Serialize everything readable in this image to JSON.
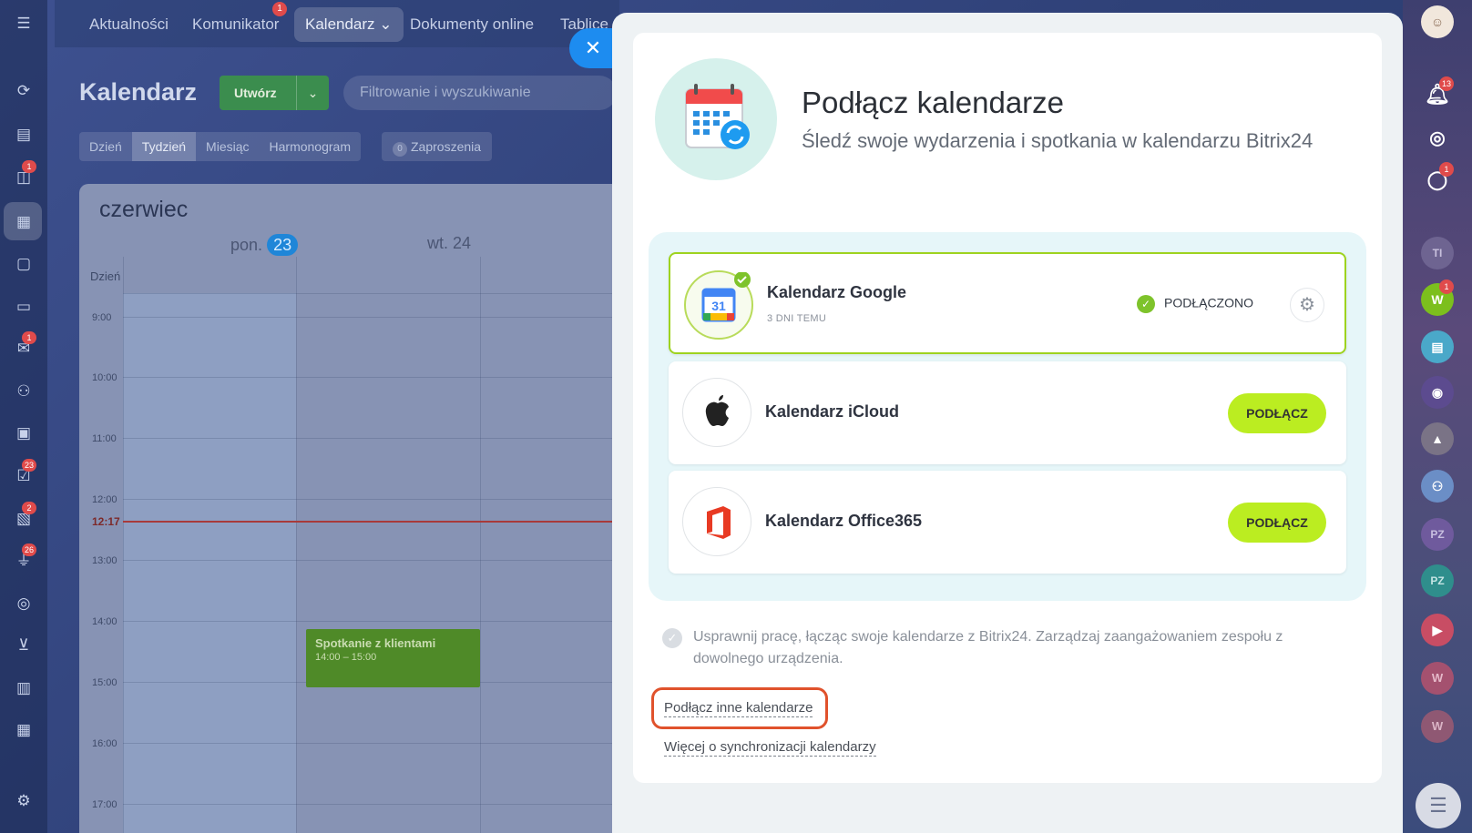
{
  "app": {
    "topnav": [
      {
        "label": "Aktualności"
      },
      {
        "label": "Komunikator",
        "badge": "1"
      },
      {
        "label": "Kalendarz"
      },
      {
        "label": "Dokumenty online"
      },
      {
        "label": "Tablice"
      }
    ],
    "calendar": {
      "title": "Kalendarz",
      "create_label": "Utwórz",
      "filter_placeholder": "Filtrowanie i wyszukiwanie",
      "views": [
        "Dzień",
        "Tydzień",
        "Miesiąc",
        "Harmonogram"
      ],
      "invites_count": "0",
      "invites_label": "Zaproszenia",
      "month": "czerwiec",
      "days": [
        {
          "label": "pon.",
          "num": "23"
        },
        {
          "label": "wt. 24"
        }
      ],
      "allday_label": "Dzień",
      "hours": [
        "9:00",
        "10:00",
        "11:00",
        "12:00",
        "13:00",
        "14:00",
        "15:00",
        "16:00",
        "17:00"
      ],
      "now_time": "12:17",
      "event": {
        "title": "Spotkanie z klientami",
        "time": "14:00 – 15:00"
      }
    },
    "left_badges": [
      "1",
      "1",
      "23",
      "2",
      "26"
    ],
    "right_rail": {
      "notifications_badge": "13",
      "chat_badge": "1",
      "avatars": [
        "TI",
        "W",
        "PZ",
        "PZ",
        "W",
        "W"
      ],
      "w_badge": "1"
    }
  },
  "slider": {
    "title": "Podłącz kalendarze",
    "subtitle": "Śledź swoje wydarzenia i spotkania w kalendarzu Bitrix24",
    "providers": [
      {
        "name": "Kalendarz Google",
        "meta": "3 DNI TEMU",
        "status": "PODŁĄCZONO",
        "icon": "google-calendar-icon"
      },
      {
        "name": "Kalendarz iCloud",
        "button": "PODŁĄCZ",
        "icon": "apple-icon"
      },
      {
        "name": "Kalendarz Office365",
        "button": "PODŁĄCZ",
        "icon": "office-icon"
      }
    ],
    "info_text": "Usprawnij pracę, łącząc swoje kalendarze z Bitrix24. Zarządzaj zaangażowaniem zespołu z dowolnego urządzenia.",
    "link_other": "Podłącz inne kalendarze",
    "link_more": "Więcej o synchronizacji kalendarzy",
    "colors": {
      "accent_green": "#bbed21",
      "highlight": "#e0522c",
      "close_blue": "#1d8cf0"
    }
  }
}
